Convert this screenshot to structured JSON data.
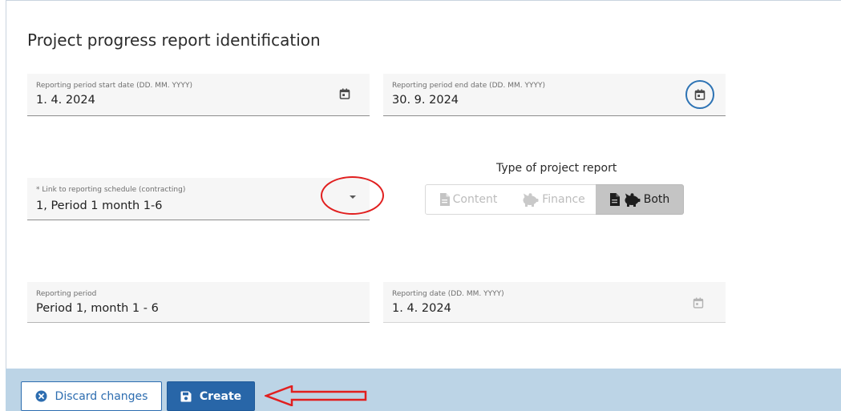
{
  "section": {
    "title": "Project progress report identification"
  },
  "fields": {
    "start_date": {
      "label": "Reporting period start date (DD. MM. YYYY)",
      "value": "1. 4. 2024"
    },
    "end_date": {
      "label": "Reporting period end date (DD. MM. YYYY)",
      "value": "30. 9. 2024"
    },
    "schedule_link": {
      "label": "* Link to reporting schedule (contracting)",
      "value": "1, Period 1 month 1-6"
    },
    "reporting_period": {
      "label": "Reporting period",
      "value": "Period 1, month 1 - 6"
    },
    "reporting_date": {
      "label": "Reporting date (DD. MM. YYYY)",
      "value": "1. 4. 2024"
    }
  },
  "report_type": {
    "heading": "Type of project report",
    "options": [
      {
        "label": "Content",
        "icon": "document-icon",
        "selected": false
      },
      {
        "label": "Finance",
        "icon": "piggy-bank-icon",
        "selected": false
      },
      {
        "label": "Both",
        "icon": "document-piggy-bank-icon",
        "selected": true
      }
    ]
  },
  "footer": {
    "discard_label": "Discard changes",
    "discard_icon": "close-circle-icon",
    "create_label": "Create",
    "create_icon": "save-icon"
  },
  "colors": {
    "primary": "#2866a8",
    "footer_bg": "#bcd4e6",
    "annotation_red": "#e11f1f",
    "field_bg": "#f6f6f6",
    "segment_selected": "#c4c4c4"
  },
  "annotations": {
    "dropdown_highlight": "red-ellipse",
    "create_pointer": "red-arrow"
  }
}
